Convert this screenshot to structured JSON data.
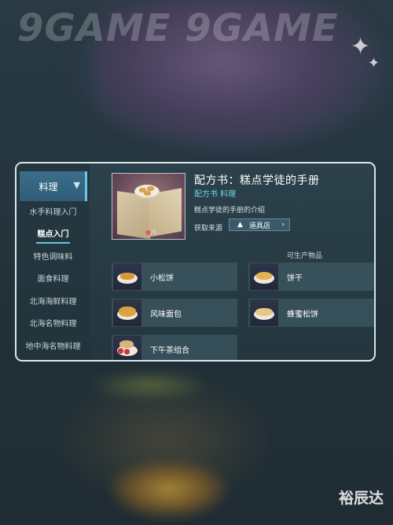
{
  "watermark": "9GAME 9GAME",
  "corner_logo": "裕辰达",
  "sidebar": {
    "category": "料理",
    "items": [
      {
        "label": "水手料理入门",
        "active": false
      },
      {
        "label": "糕点入门",
        "active": true
      },
      {
        "label": "特色调味料",
        "active": false
      },
      {
        "label": "面食料理",
        "active": false
      },
      {
        "label": "北海海鲜料理",
        "active": false
      },
      {
        "label": "北海名物料理",
        "active": false
      },
      {
        "label": "地中海名物料理",
        "active": false
      }
    ]
  },
  "detail": {
    "title": "配方书：糕点学徒的手册",
    "type": "配方书 料理",
    "description": "糕点学徒的手册的介绍",
    "source_label": "获取来源",
    "source_button": "道具店",
    "count": "/1"
  },
  "produce": {
    "title": "可生产物品",
    "items": [
      {
        "name": "小松饼"
      },
      {
        "name": "饼干"
      },
      {
        "name": "风味面包"
      },
      {
        "name": "蜂蜜松饼"
      },
      {
        "name": "下午茶组合"
      }
    ]
  },
  "colors": {
    "accent": "#6cc3e6",
    "type_text": "#6fd3dc",
    "panel_border": "#d9e6ea"
  }
}
